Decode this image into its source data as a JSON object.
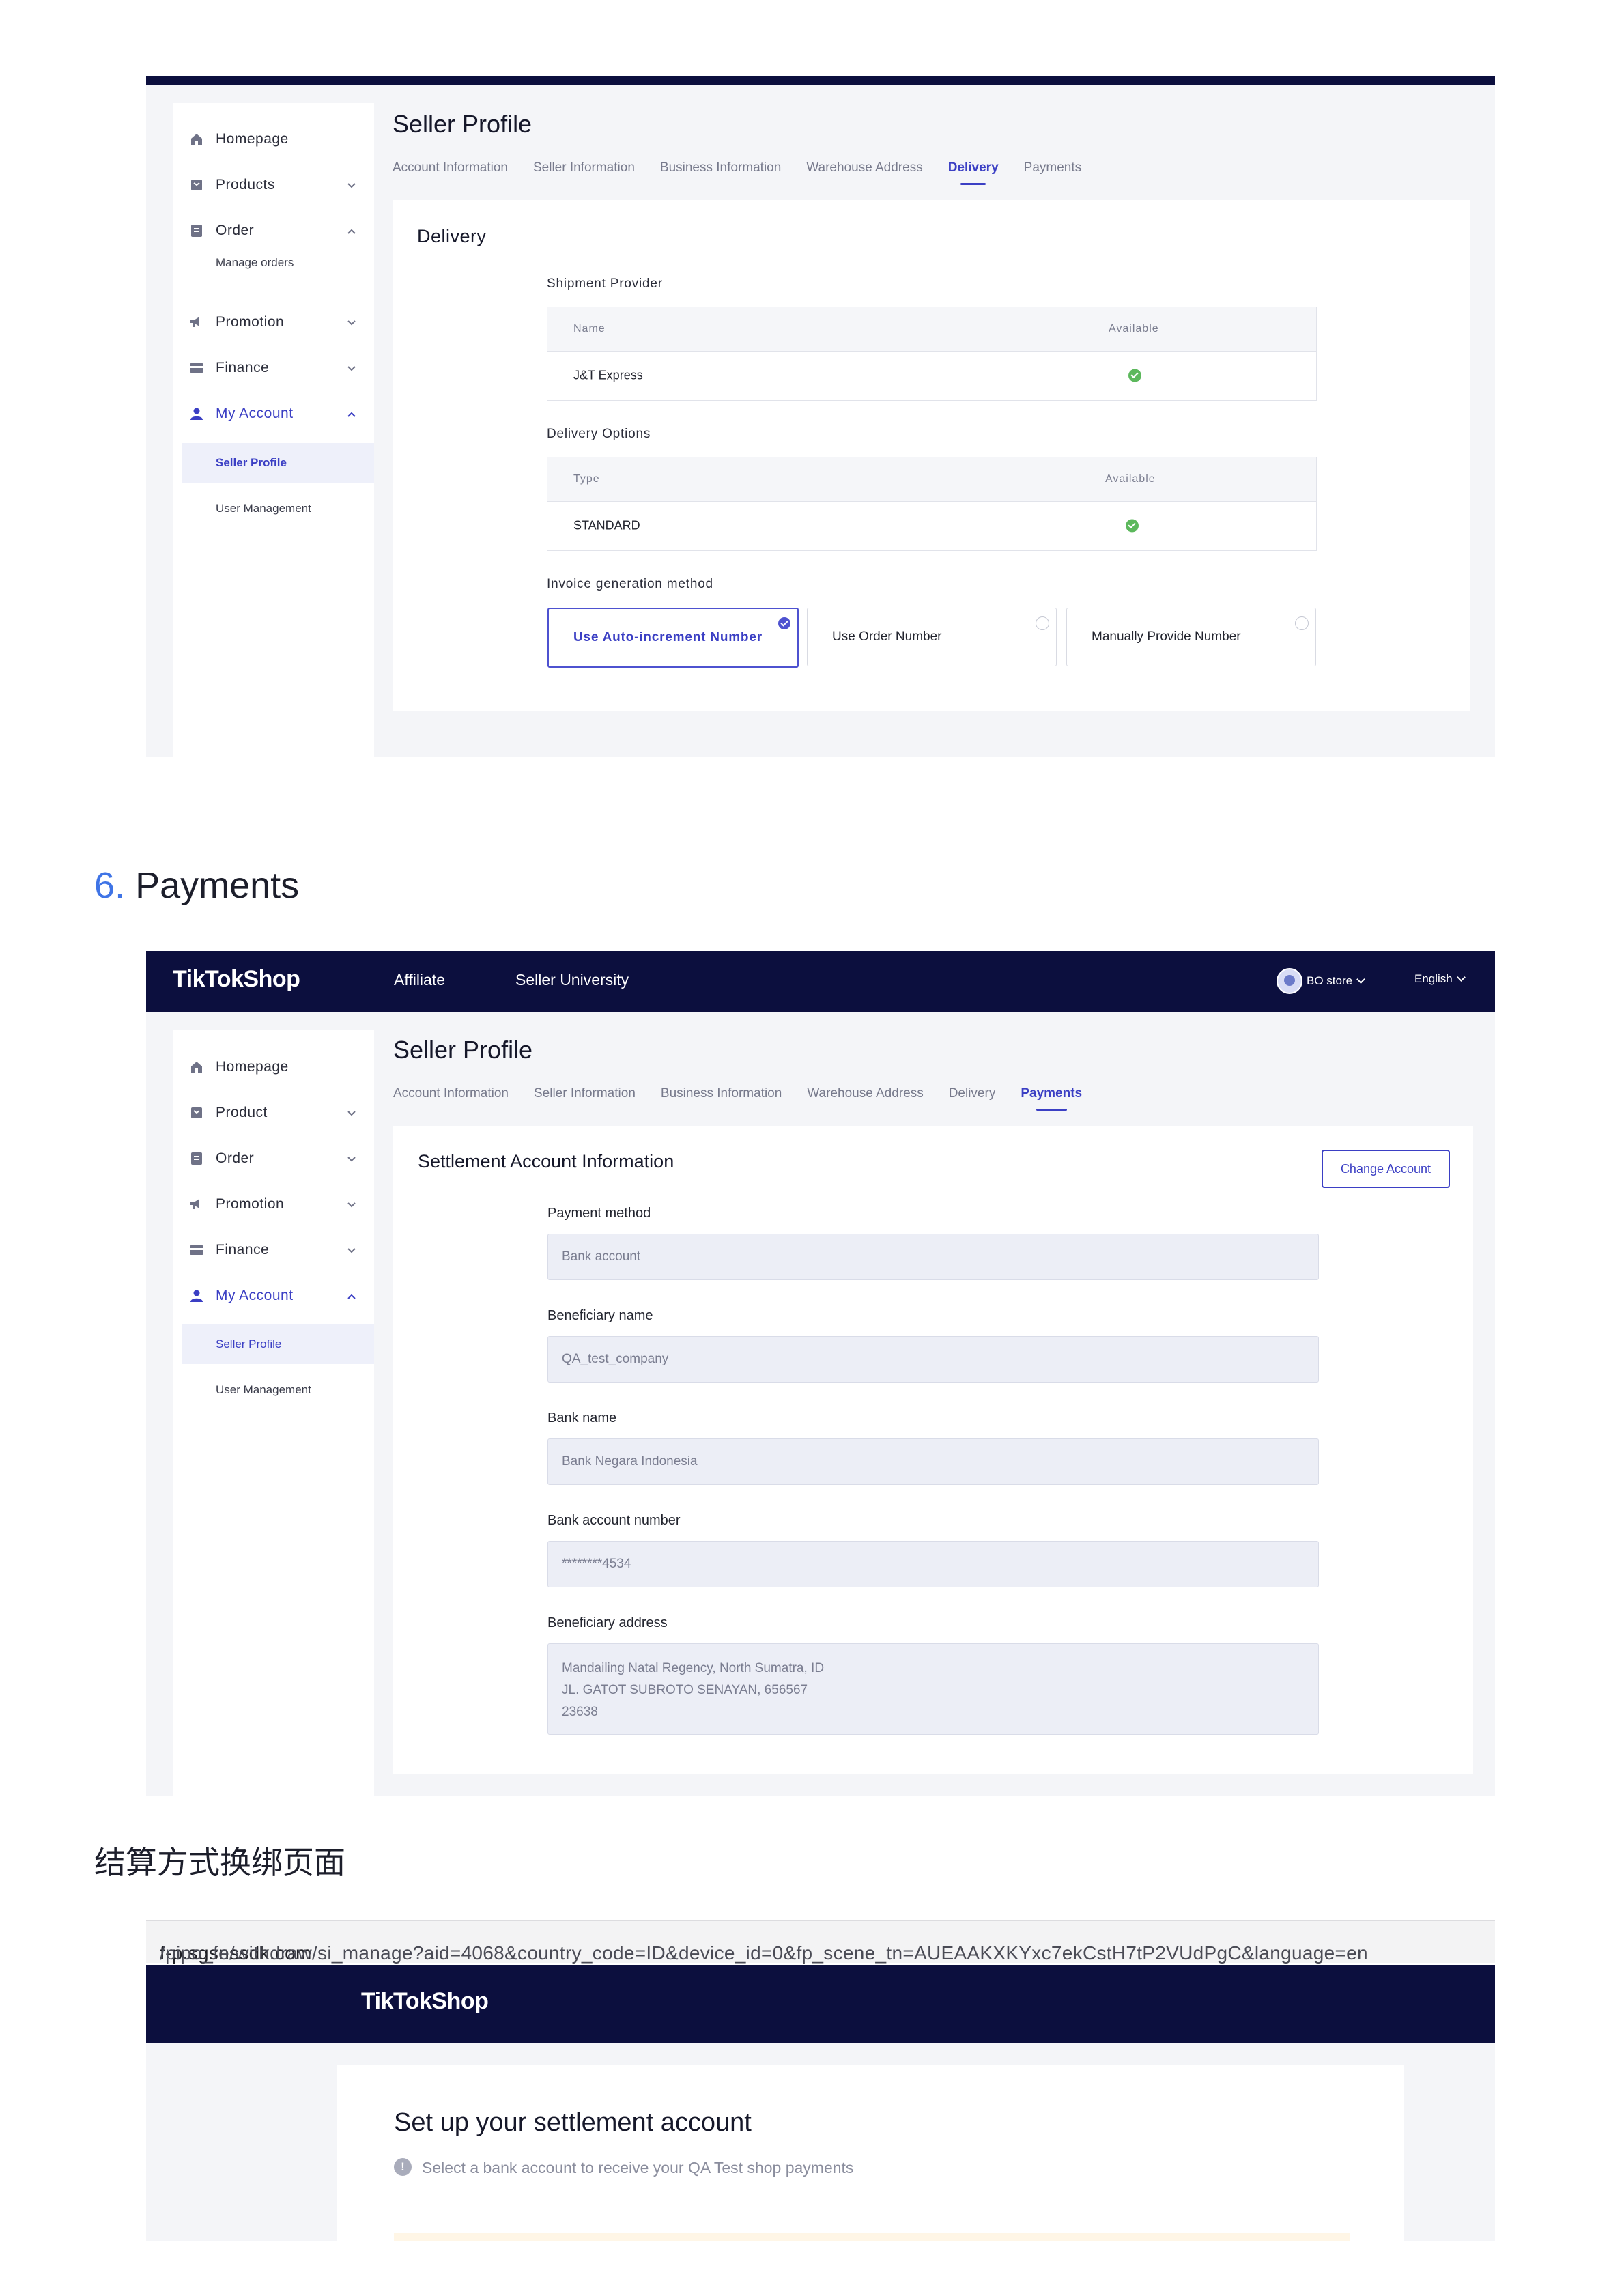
{
  "delivery_screen": {
    "sidebar": {
      "items": [
        {
          "label": "Homepage",
          "icon": "home-icon"
        },
        {
          "label": "Products",
          "icon": "product-icon"
        },
        {
          "label": "Order",
          "icon": "order-icon"
        },
        {
          "label": "Promotion",
          "icon": "megaphone-icon"
        },
        {
          "label": "Finance",
          "icon": "card-icon"
        },
        {
          "label": "My Account",
          "icon": "user-icon"
        }
      ],
      "order_sub": "Manage orders",
      "account_sub": [
        "Seller Profile",
        "User Management"
      ]
    },
    "title": "Seller Profile",
    "tabs": [
      "Account Information",
      "Seller Information",
      "Business Information",
      "Warehouse Address",
      "Delivery",
      "Payments"
    ],
    "active_tab": "Delivery",
    "card_title": "Delivery",
    "shipment_provider": {
      "label": "Shipment Provider",
      "headers": [
        "Name",
        "Available"
      ],
      "rows": [
        {
          "name": "J&T Express",
          "available": true
        }
      ]
    },
    "delivery_options": {
      "label": "Delivery Options",
      "headers": [
        "Type",
        "Available"
      ],
      "rows": [
        {
          "name": "STANDARD",
          "available": true
        }
      ]
    },
    "invoice": {
      "label": "Invoice generation method",
      "options": [
        "Use Auto-increment Number",
        "Use Order Number",
        "Manually Provide Number"
      ],
      "selected": "Use Auto-increment Number"
    }
  },
  "heading": {
    "number": "6.",
    "text": "Payments"
  },
  "payments_screen": {
    "navbar": {
      "brand": "TikTokShop",
      "links": [
        "Affiliate",
        "Seller University"
      ],
      "store": "BO store",
      "language": "English"
    },
    "sidebar": {
      "items": [
        {
          "label": "Homepage",
          "icon": "home-icon"
        },
        {
          "label": "Product",
          "icon": "product-icon"
        },
        {
          "label": "Order",
          "icon": "order-icon"
        },
        {
          "label": "Promotion",
          "icon": "megaphone-icon"
        },
        {
          "label": "Finance",
          "icon": "card-icon"
        },
        {
          "label": "My Account",
          "icon": "user-icon"
        }
      ],
      "account_sub": [
        "Seller Profile",
        "User Management"
      ]
    },
    "title": "Seller Profile",
    "tabs": [
      "Account Information",
      "Seller Information",
      "Business Information",
      "Warehouse Address",
      "Delivery",
      "Payments"
    ],
    "active_tab": "Payments",
    "card_title": "Settlement Account Information",
    "change_button": "Change Account",
    "fields": [
      {
        "label": "Payment method",
        "value": "Bank account"
      },
      {
        "label": "Beneficiary name",
        "value": "QA_test_company"
      },
      {
        "label": "Bank name",
        "value": "Bank Negara Indonesia"
      },
      {
        "label": "Bank account number",
        "value": "********4534"
      }
    ],
    "address": {
      "label": "Beneficiary address",
      "lines": [
        "Mandailing Natal Regency, North Sumatra, ID",
        "JL. GATOT SUBROTO SENAYAN, 656567",
        "23638"
      ]
    }
  },
  "chinese_title": "结算方式换绑页面",
  "settlement_screen": {
    "url_host": "f-p.sgsnssdk.com",
    "url_path": "/pipo_fe/withdraw/si_manage?aid=4068&country_code=ID&device_id=0&fp_scene_tn=AUEAAKXKYxc7ekCstH7tP2VUdPgC&language=en",
    "brand": "TikTokShop",
    "title": "Set up your settlement account",
    "subtitle": "Select a bank account to receive your QA Test shop payments"
  },
  "colors": {
    "navy": "#0c0f3e",
    "accent": "#3b3fc4",
    "success": "#5cb85c",
    "heading_number": "#3f74e6"
  }
}
